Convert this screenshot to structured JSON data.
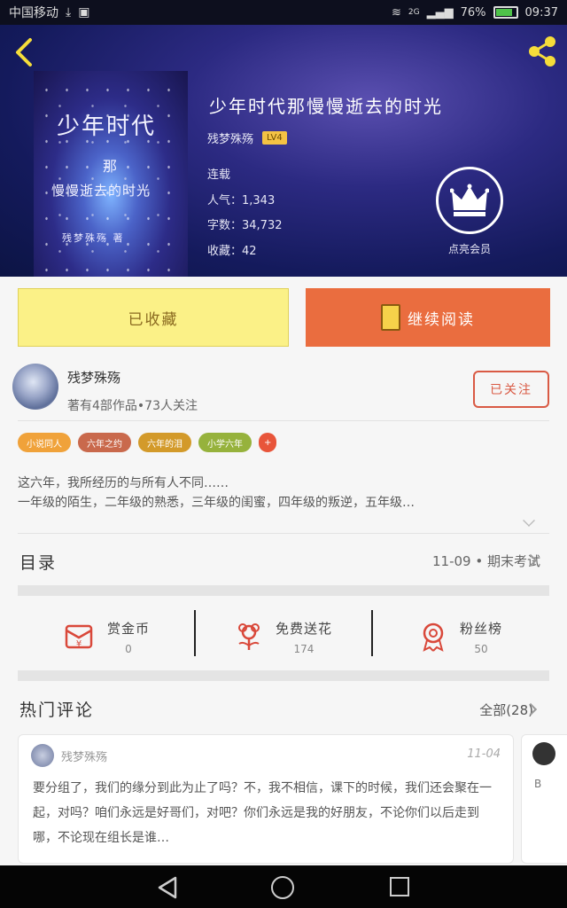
{
  "status_bar": {
    "carrier": "中国移动",
    "network": "2G",
    "battery": "76%",
    "time": "09:37"
  },
  "header": {
    "cover_text": {
      "line1": "少年时代",
      "line2": "那",
      "line3": "慢慢逝去的时光",
      "author": "残梦殊殇 著"
    },
    "title": "少年时代那慢慢逝去的时光",
    "author": "残梦殊殇",
    "level": "LV4",
    "status": "连载",
    "popularity": "人气：1,343",
    "word_count": "字数：34,732",
    "favorites": "收藏：42",
    "vip_label": "点亮会员"
  },
  "actions": {
    "favorited_label": "已收藏",
    "continue_label": "继续阅读"
  },
  "author_section": {
    "name": "残梦殊殇",
    "info": "著有4部作品•73人关注",
    "follow_label": "已关注"
  },
  "tags": [
    {
      "label": "小说同人",
      "color": "#f0a23a"
    },
    {
      "label": "六年之约",
      "color": "#c9694c"
    },
    {
      "label": "六年的泪",
      "color": "#d39a2a"
    },
    {
      "label": "小学六年",
      "color": "#96b23c"
    },
    {
      "label": "+",
      "color": "#e8553a"
    }
  ],
  "intro": {
    "line1": "这六年，我所经历的与所有人不同……",
    "line2": "一年级的陌生，二年级的熟悉，三年级的闺蜜，四年级的叛逆，五年级…"
  },
  "catalog": {
    "label": "目录",
    "latest": "11-09 • 期末考试"
  },
  "stats": [
    {
      "label": "赏金币",
      "value": "0",
      "icon": "red-envelope-icon"
    },
    {
      "label": "免费送花",
      "value": "174",
      "icon": "flower-icon"
    },
    {
      "label": "粉丝榜",
      "value": "50",
      "icon": "medal-icon"
    }
  ],
  "comments": {
    "label": "热门评论",
    "all_label": "全部(28)",
    "items": [
      {
        "user": "残梦殊殇",
        "date": "11-04",
        "text": "要分组了，我们的缘分到此为止了吗？不，我不相信，课下的时候，我们还会聚在一起，对吗？咱们永远是好哥们，对吧？你们永远是我的好朋友，不论你们以后走到哪，不论现在组长是谁…"
      }
    ],
    "next_preview": "B"
  },
  "colors": {
    "accent_orange": "#ea6d3f",
    "fav_yellow": "#fbf187",
    "follow_red": "#d95a44"
  }
}
